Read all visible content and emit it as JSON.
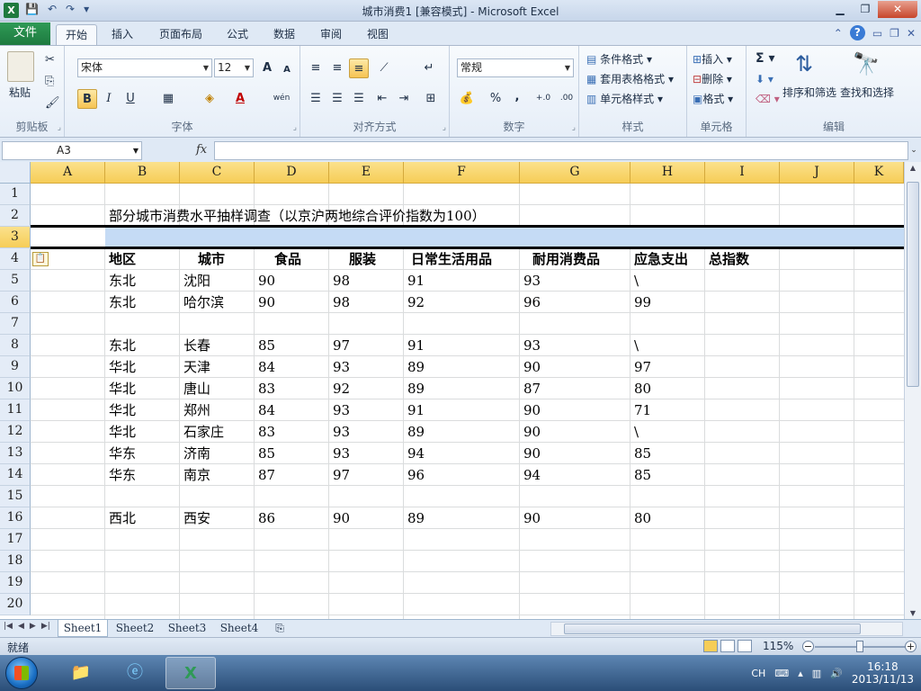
{
  "window": {
    "title": "城市消费1 [兼容模式] - Microsoft Excel",
    "app_icon": "X"
  },
  "ribbon": {
    "file_tab": "文件",
    "tabs": [
      "开始",
      "插入",
      "页面布局",
      "公式",
      "数据",
      "审阅",
      "视图"
    ],
    "clipboard": {
      "paste": "粘贴",
      "label": "剪贴板"
    },
    "font": {
      "name": "宋体",
      "size": "12",
      "label": "字体",
      "bold": "B",
      "italic": "I",
      "underline": "U",
      "grow": "A",
      "shrink": "A",
      "color_letter": "A",
      "wen": "wén"
    },
    "alignment": {
      "label": "对齐方式"
    },
    "number": {
      "format": "常规",
      "label": "数字",
      "percent": "%",
      "comma": ",",
      "inc": "+.0",
      "dec": ".00"
    },
    "styles": {
      "conditional": "条件格式",
      "table": "套用表格格式",
      "cell": "单元格样式",
      "label": "样式"
    },
    "cells": {
      "insert": "插入",
      "delete": "删除",
      "format": "格式",
      "label": "单元格"
    },
    "editing": {
      "sigma": "Σ",
      "sort": "排序和筛选",
      "find": "查找和选择",
      "label": "编辑"
    }
  },
  "formula_bar": {
    "name_box": "A3",
    "fx": "fx",
    "value": ""
  },
  "grid": {
    "columns": [
      "A",
      "B",
      "C",
      "D",
      "E",
      "F",
      "G",
      "H",
      "I",
      "J",
      "K"
    ],
    "rows": [
      "1",
      "2",
      "3",
      "4",
      "5",
      "6",
      "7",
      "8",
      "9",
      "10",
      "11",
      "12",
      "13",
      "14",
      "15",
      "16",
      "17",
      "18",
      "19",
      "20"
    ],
    "title": "部分城市消费水平抽样调查（以京沪两地综合评价指数为100）",
    "headers": [
      "地区",
      "城市",
      "食品",
      "服装",
      "日常生活用品",
      "耐用消费品",
      "应急支出",
      "总指数"
    ],
    "data_rows": [
      {
        "row": 5,
        "cells": [
          "东北",
          "沈阳",
          "90",
          "98",
          "91",
          "93",
          "\\"
        ]
      },
      {
        "row": 6,
        "cells": [
          "东北",
          "哈尔滨",
          "90",
          "98",
          "92",
          "96",
          "99"
        ]
      },
      {
        "row": 8,
        "cells": [
          "东北",
          "长春",
          "85",
          "97",
          "91",
          "93",
          "\\"
        ]
      },
      {
        "row": 9,
        "cells": [
          "华北",
          "天津",
          "84",
          "93",
          "89",
          "90",
          "97"
        ]
      },
      {
        "row": 10,
        "cells": [
          "华北",
          "唐山",
          "83",
          "92",
          "89",
          "87",
          "80"
        ]
      },
      {
        "row": 11,
        "cells": [
          "华北",
          "郑州",
          "84",
          "93",
          "91",
          "90",
          "71"
        ]
      },
      {
        "row": 12,
        "cells": [
          "华北",
          "石家庄",
          "83",
          "93",
          "89",
          "90",
          "\\"
        ]
      },
      {
        "row": 13,
        "cells": [
          "华东",
          "济南",
          "85",
          "93",
          "94",
          "90",
          "85"
        ]
      },
      {
        "row": 14,
        "cells": [
          "华东",
          "南京",
          "87",
          "97",
          "96",
          "94",
          "85"
        ]
      },
      {
        "row": 16,
        "cells": [
          "西北",
          "西安",
          "86",
          "90",
          "89",
          "90",
          "80"
        ]
      }
    ]
  },
  "sheets": {
    "tabs": [
      "Sheet1",
      "Sheet2",
      "Sheet3",
      "Sheet4"
    ],
    "active": "Sheet1"
  },
  "status": {
    "ready": "就绪",
    "zoom": "115%"
  },
  "taskbar": {
    "input_lang": "CH",
    "time": "16:18",
    "date": "2013/11/13"
  }
}
